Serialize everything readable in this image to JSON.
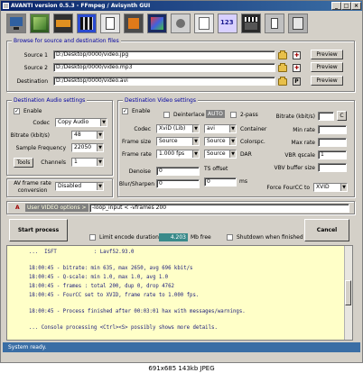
{
  "window": {
    "title": "AVANTI  version  0.5.3  -  FFmpeg / Avisynth GUI"
  },
  "source_section": {
    "title": "Browse for source and destination files",
    "rows": [
      {
        "label": "Source 1",
        "value": "D:/Desktop/0000/video.jpg",
        "preview": "Preview"
      },
      {
        "label": "Source 2",
        "value": "D:/Desktop/0000/video.mp3",
        "preview": "Preview"
      },
      {
        "label": "Destination",
        "value": "D:/Desktop/0000/video.avi",
        "preview": "Preview",
        "p_label": "P"
      }
    ]
  },
  "audio": {
    "title": "Destination Audio settings",
    "enable_label": "Enable",
    "codec_label": "Codec",
    "codec_value": "Copy Audio",
    "bitrate_label": "Bitrate (kbit/s)",
    "bitrate_value": "48",
    "samplefreq_label": "Sample Frequency",
    "samplefreq_value": "22050",
    "tools_label": "Tools",
    "channels_label": "Channels",
    "channels_value": "1"
  },
  "av_rate": {
    "label_line1": "AV frame rate",
    "label_line2": "conversion",
    "value": "Disabled"
  },
  "video": {
    "title": "Destination Video settings",
    "enable_label": "Enable",
    "deinterlace_label": "Deinterlace",
    "auto_label": "AUTO",
    "twopass_label": "2-pass",
    "codec_label": "Codec",
    "codec_value": "XviD (Lib)",
    "container_value": "avi",
    "container_label": "Container",
    "framesize_label": "Frame size",
    "framesize_value": "Source",
    "colorspc_value": "Source",
    "colorspc_label": "Colorspc.",
    "framerate_label": "Frame rate",
    "framerate_value": "1.000 fps",
    "dar_value": "Source",
    "dar_label": "DAR",
    "denoise_label": "Denoise",
    "denoise_value": "0",
    "ts_label": "TS offset",
    "blur_label": "Blur/Sharpen",
    "blur_value": "0",
    "ts_value": "0",
    "ts_unit": "ms",
    "bitrate_label": "Bitrate (kbit/s)",
    "c_label": "C",
    "minrate_label": "Min rate",
    "maxrate_label": "Max rate",
    "vbrq_label": "VBR qscale",
    "vbrq_value": "1",
    "vbvbuf_label": "VBV buffer size",
    "fourcc_label": "Force FourCC to",
    "fourcc_value": "XVID"
  },
  "options": {
    "label": "User VIDEO options >",
    "value": "-loop_input < -vframes 200"
  },
  "actions": {
    "start": "Start process",
    "limit_label": "Limit encode duration",
    "mb_free_value": "4.203",
    "mb_free_unit": "Mb free",
    "shutdown_label": "Shutdown when finished",
    "cancel": "Cancel"
  },
  "log_lines": [
    "...  ISFT            : Lavf52.93.0",
    "18:00:45 - bitrate: min 635, max 2650, avg 696 kbit/s",
    "18:00:45 - Q-scale: min 1.0, max 1.0, avg 1.0",
    "18:00:45 - frames : total 200, dup 0, drop 4762",
    "18:00:45 - FourCC set to XVID, frame rate to 1.000 fps.",
    "18:00:45 - Process finished after 00:03:01 hax with messages/warnings.",
    "... Console processing <Ctrl><S> possibly shows more details."
  ],
  "status": "System ready.",
  "caption": "691x685 143kb JPEG"
}
